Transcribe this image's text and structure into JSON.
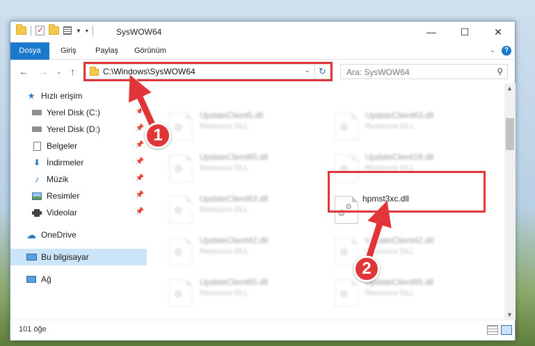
{
  "window": {
    "title": "SysWOW64",
    "minimize": "—",
    "maximize": "☐",
    "close": "✕"
  },
  "ribbon": {
    "tabs": [
      "Dosya",
      "Giriş",
      "Paylaş",
      "Görünüm"
    ],
    "help": "?"
  },
  "nav": {
    "address": "C:\\Windows\\SysWOW64",
    "search_placeholder": "Ara: SysWOW64"
  },
  "sidebar": {
    "items": [
      {
        "label": "Hızlı erişim",
        "icon": "star-icon"
      },
      {
        "label": "Yerel Disk (C:)",
        "icon": "drive-icon",
        "pinned": true
      },
      {
        "label": "Yerel Disk (D:)",
        "icon": "drive-icon",
        "pinned": true
      },
      {
        "label": "Belgeler",
        "icon": "document-icon",
        "pinned": true
      },
      {
        "label": "İndirmeler",
        "icon": "download-icon",
        "pinned": true
      },
      {
        "label": "Müzik",
        "icon": "music-icon",
        "pinned": true
      },
      {
        "label": "Resimler",
        "icon": "pictures-icon",
        "pinned": true
      },
      {
        "label": "Videolar",
        "icon": "video-icon",
        "pinned": true
      },
      {
        "label": "OneDrive",
        "icon": "cloud-icon"
      },
      {
        "label": "Bu bilgisayar",
        "icon": "computer-icon",
        "selected": true
      },
      {
        "label": "Ağ",
        "icon": "network-icon"
      }
    ]
  },
  "files": [
    {
      "name": "UpdateClient5.dll",
      "desc": "Resource DLL",
      "blurred": true
    },
    {
      "name": "UpdateClient63.dll",
      "desc": "Resource DLL",
      "blurred": true
    },
    {
      "name": "UpdateClient65.dll",
      "desc": "Resource DLL",
      "blurred": true
    },
    {
      "name": "UpdateClient19.dll",
      "desc": "Resource DLL",
      "blurred": true
    },
    {
      "name": "UpdateClient63.dll",
      "desc": "Resource DLL",
      "blurred": true
    },
    {
      "name": "hpmst3xc.dll",
      "desc": "",
      "blurred": false
    },
    {
      "name": "UpdateClient42.dll",
      "desc": "Resource DLL",
      "blurred": true
    },
    {
      "name": "UpdateClient42.dll",
      "desc": "Resource DLL",
      "blurred": true
    },
    {
      "name": "UpdateClient65.dll",
      "desc": "Resource DLL",
      "blurred": true
    },
    {
      "name": "UpdateClient65.dll",
      "desc": "Resource DLL",
      "blurred": true
    }
  ],
  "status": {
    "count": "101 öğe"
  },
  "annotations": {
    "badge1": "1",
    "badge2": "2",
    "color": "#e0363a"
  }
}
